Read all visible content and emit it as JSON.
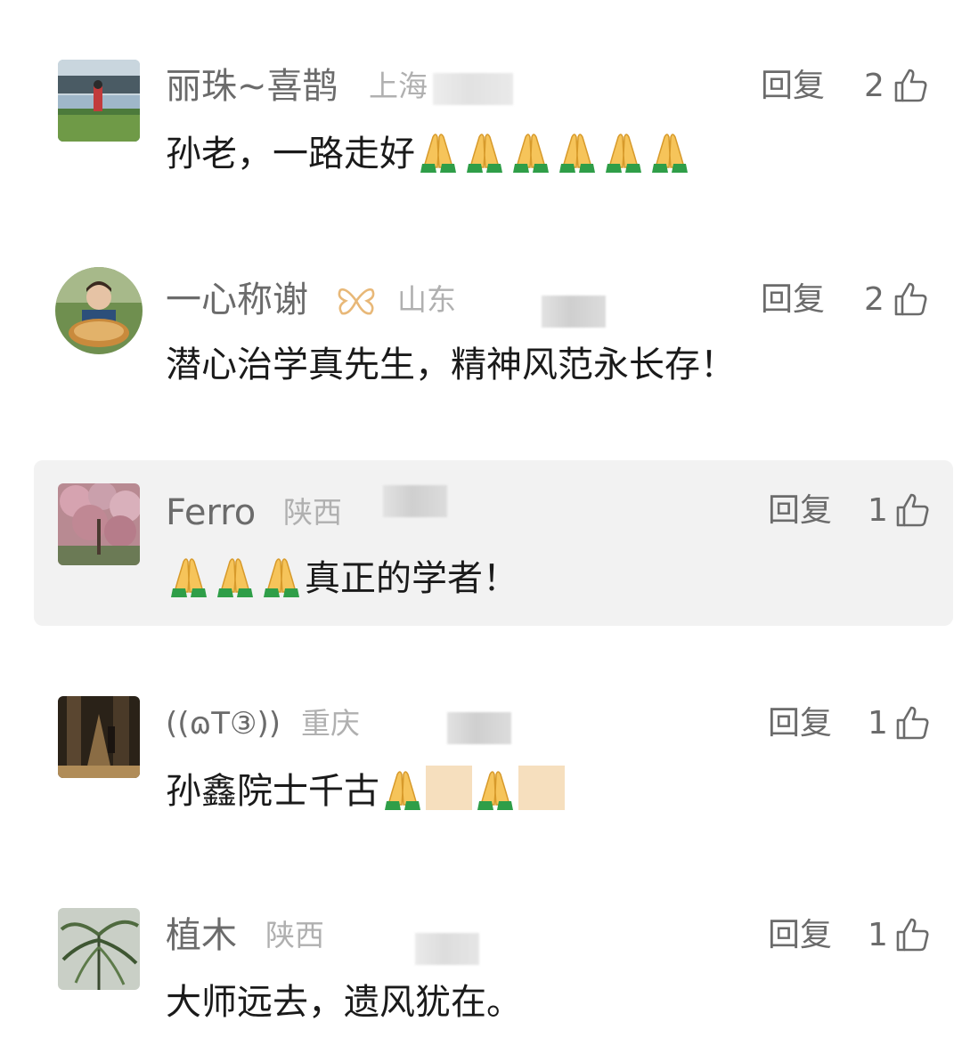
{
  "comments": [
    {
      "name": "丽珠~喜鹊",
      "region": "上海",
      "reply_label": "回复",
      "likes": "2",
      "text": "孙老，一路走好",
      "emoji_count": 6
    },
    {
      "name": "一心称谢",
      "region": "山东",
      "reply_label": "回复",
      "likes": "2",
      "text": "潜心治学真先生，精神风范永长存！"
    },
    {
      "name": "Ferro",
      "region": "陕西",
      "reply_label": "回复",
      "likes": "1",
      "text": "真正的学者！",
      "emoji_count": 3
    },
    {
      "name": "((ɷT③))",
      "region": "重庆",
      "reply_label": "回复",
      "likes": "1",
      "text": "孙鑫院士千古"
    },
    {
      "name": "植木",
      "region": "陕西",
      "reply_label": "回复",
      "likes": "1",
      "text": "大师远去，遗风犹在。"
    }
  ],
  "icons": {
    "like": "thumbs-up-outline-icon",
    "emoji": "folded-hands-emoji",
    "badge": "butterfly-badge-icon"
  },
  "colors": {
    "name": "#6b6b6b",
    "region": "#b0b0b0",
    "text": "#1a1a1a",
    "highlight_bg": "#f2f2f2",
    "badge": "#e8b878"
  }
}
